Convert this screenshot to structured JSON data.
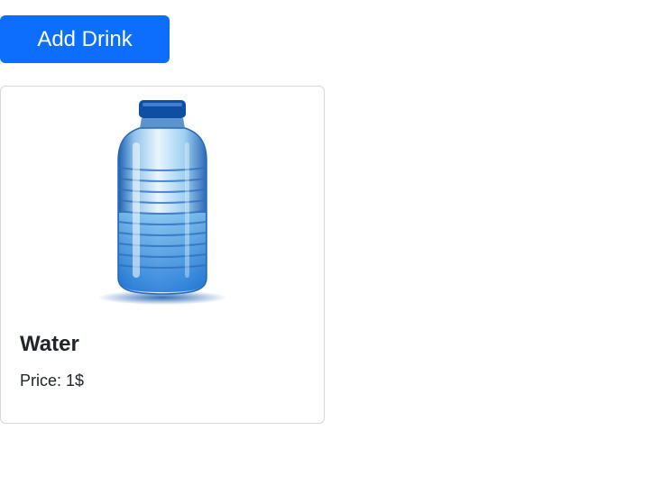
{
  "toolbar": {
    "add_drink_label": "Add Drink"
  },
  "colors": {
    "primary": "#0d6efd",
    "text": "#212529",
    "card_border": "#d8d8d8"
  },
  "drinks": [
    {
      "name": "Water",
      "price_label": "Price: ",
      "price_value": "1$",
      "image_icon": "water-bottle-icon"
    }
  ]
}
